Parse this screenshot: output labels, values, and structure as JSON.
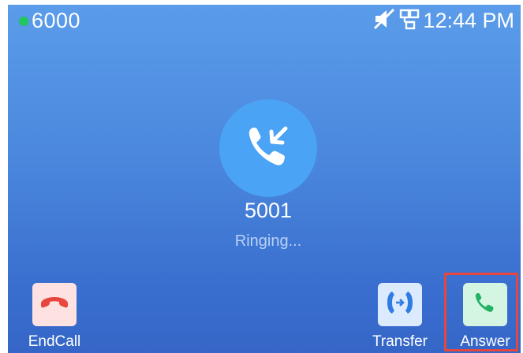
{
  "status_bar": {
    "extension": "6000",
    "time": "12:44 PM",
    "status_color": "#22c55e",
    "icons": [
      "mute-icon",
      "network-icon"
    ]
  },
  "call": {
    "number": "5001",
    "status": "Ringing...",
    "icon": "incoming-call-icon",
    "circle_color": "#4aa3f5"
  },
  "softkeys": {
    "endcall": {
      "label": "EndCall",
      "icon": "hangup-icon",
      "bg": "#fde2e1",
      "icon_color": "#e8463c"
    },
    "transfer": {
      "label": "Transfer",
      "icon": "transfer-icon",
      "bg": "#dceafe",
      "icon_color": "#2f7de1"
    },
    "answer": {
      "label": "Answer",
      "icon": "phone-answer-icon",
      "bg": "#d4f5e1",
      "icon_color": "#22b264"
    }
  },
  "highlight_color": "#e2483f"
}
